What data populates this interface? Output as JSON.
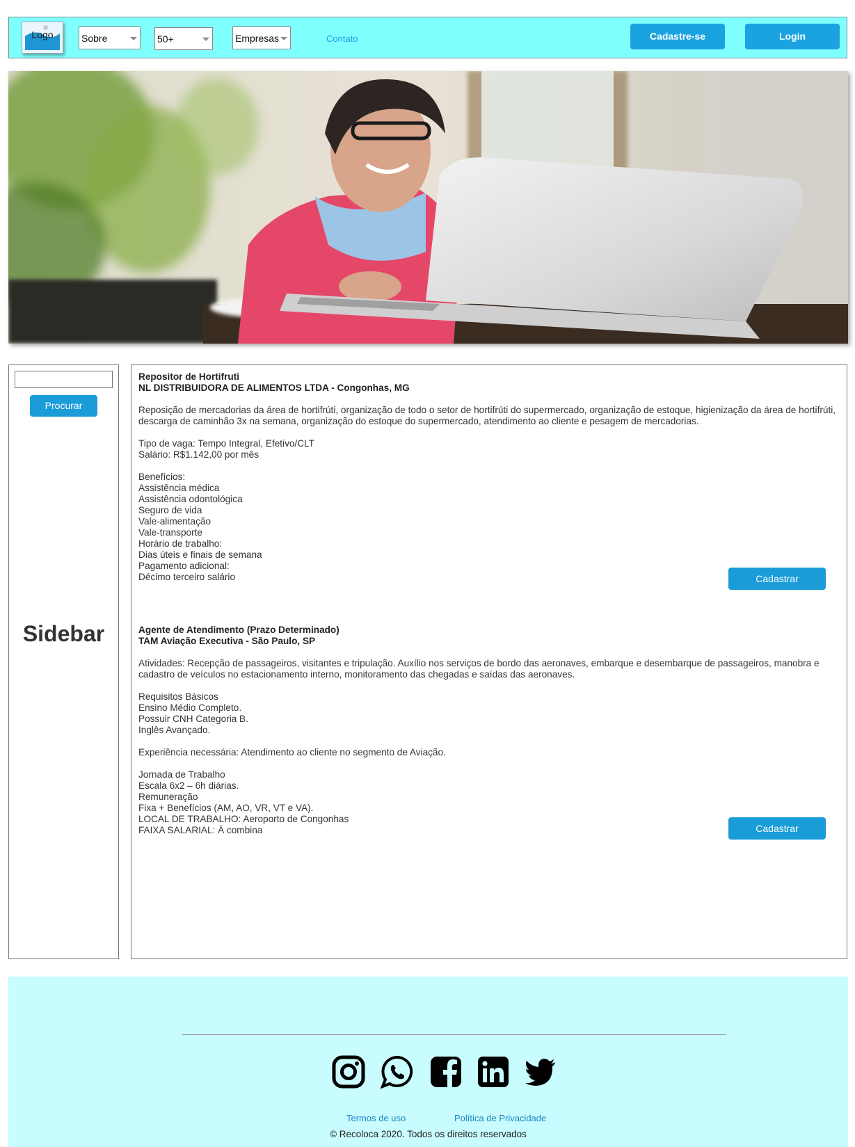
{
  "header": {
    "logo_label": "Logo",
    "menus": [
      {
        "label": "Sobre"
      },
      {
        "label": "50+"
      },
      {
        "label": "Empresas"
      }
    ],
    "contact_link": "Contato",
    "signup_button": "Cadastre-se",
    "login_button": "Login"
  },
  "hero": {
    "image_subject": "woman-using-laptop"
  },
  "sidebar": {
    "search_placeholder": "",
    "search_button": "Procurar",
    "title": "Sidebar"
  },
  "jobs": [
    {
      "title": "Repositor de Hortifruti",
      "company": "NL DISTRIBUIDORA DE ALIMENTOS LTDA - Congonhas, MG",
      "description": "Reposição de mercadorias da área de hortifrúti, organização de todo o setor de hortifrúti do supermercado, organização de estoque, higienização da área de hortifrúti, descarga de caminhão 3x na semana, organização do estoque do supermercado, atendimento ao cliente e pesagem de mercadorias.",
      "details_1": [
        "Tipo de vaga: Tempo Integral, Efetivo/CLT",
        "Salário: R$1.142,00 por mês"
      ],
      "details_2": [
        "Benefícios:",
        "Assistência médica",
        "Assistência odontológica",
        "Seguro de vida",
        "Vale-alimentação",
        "Vale-transporte",
        "Horário de trabalho:",
        "Dias úteis e finais de semana",
        "Pagamento adicional:",
        "Décimo terceiro salário"
      ],
      "button": "Cadastrar"
    },
    {
      "title": "Agente de Atendimento (Prazo Determinado)",
      "company": "TAM Aviação Executiva - São Paulo, SP",
      "description": "Atividades: Recepção de passageiros, visitantes e tripulação. Auxílio nos serviços de bordo das aeronaves, embarque e desembarque de passageiros, manobra e cadastro de veículos no estacionamento interno, monitoramento das chegadas e saídas das aeronaves.",
      "details_1": [
        "Requisitos Básicos",
        "Ensino Médio Completo.",
        "Possuir CNH Categoria B.",
        "Inglês Avançado."
      ],
      "details_2": [
        "Experiência necessária: Atendimento ao cliente no segmento de Aviação."
      ],
      "details_3": [
        "Jornada de Trabalho",
        "Escala 6x2 – 6h diárias.",
        "Remuneração",
        "Fixa + Benefícios (AM, AO, VR, VT e VA).",
        "LOCAL DE TRABALHO: Aeroporto de Congonhas",
        "FAIXA SALARIAL: À combina"
      ],
      "button": "Cadastrar"
    }
  ],
  "footer": {
    "social_icons": [
      "instagram-icon",
      "whatsapp-icon",
      "facebook-icon",
      "linkedin-icon",
      "twitter-icon"
    ],
    "terms_link": "Termos de uso",
    "privacy_link": "Política de Privacidade",
    "copyright": "© Recoloca 2020. Todos os direitos reservados"
  },
  "colors": {
    "header_bg": "#80ffff",
    "footer_bg": "#c8fcfe",
    "button_blue": "#1aa3e0",
    "link_blue": "#1a9ddb"
  }
}
